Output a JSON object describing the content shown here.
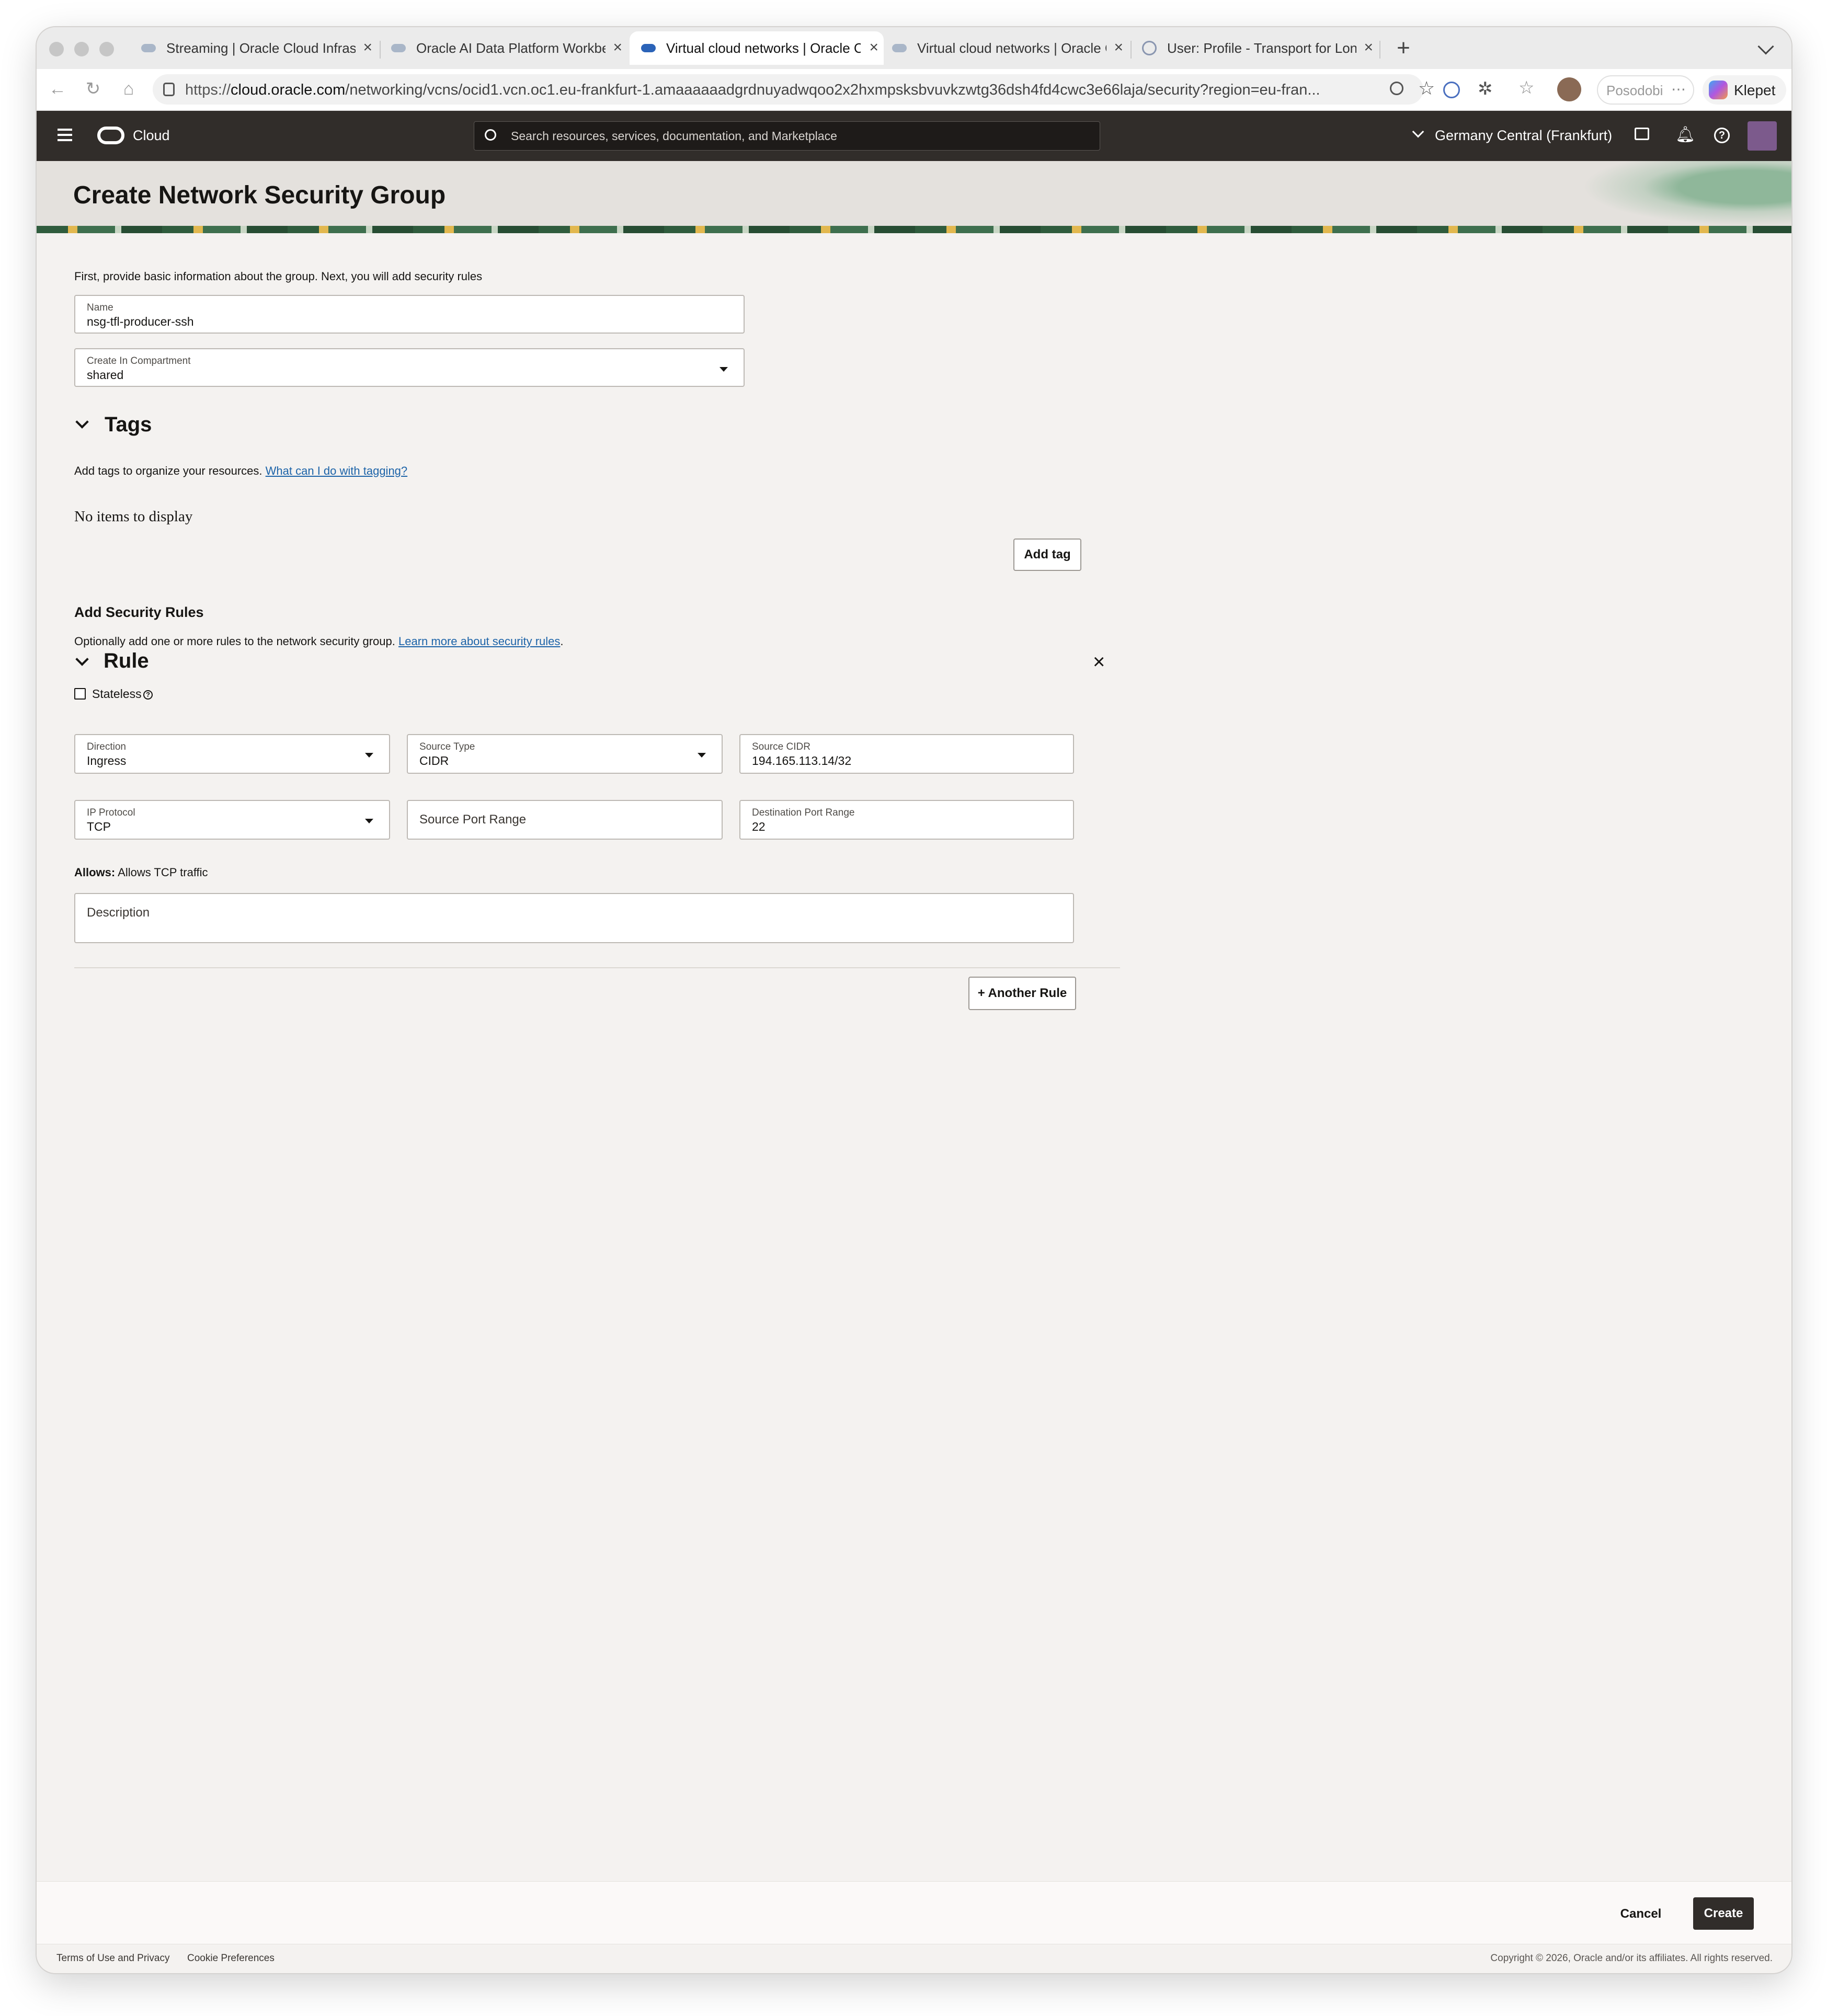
{
  "browser": {
    "tabs": [
      {
        "title": "Streaming | Oracle Cloud Infrast"
      },
      {
        "title": "Oracle AI Data Platform Workbe"
      },
      {
        "title": "Virtual cloud networks | Oracle C"
      },
      {
        "title": "Virtual cloud networks | Oracle C"
      },
      {
        "title": "User: Profile - Transport for Lon"
      }
    ],
    "url_prefix": "https://",
    "url_host": "cloud.oracle.com",
    "url_path": "/networking/vcns/ocid1.vcn.oc1.eu-frankfurt-1.amaaaaaadgrdnuyadwqoo2x2hxmpsksbvuvkzwtg36dsh4fd4cwc3e66laja/security?region=eu-fran...",
    "profile_label": "Posodobi",
    "copilot_label": "Klepet",
    "icons": [
      "back-icon",
      "reload-icon",
      "home-icon",
      "site-info-icon",
      "zoom-icon",
      "bookmark-star-icon",
      "password-icon",
      "extensions-icon",
      "favorites-icon",
      "profile-avatar",
      "more-icon",
      "copilot-icon",
      "new-tab-icon",
      "tab-list-icon"
    ]
  },
  "header": {
    "brand": "Cloud",
    "search_placeholder": "Search resources, services, documentation, and Marketplace",
    "region": "Germany Central (Frankfurt)"
  },
  "page": {
    "title": "Create Network Security Group",
    "intro": "First, provide basic information about the group. Next, you will add security rules",
    "name_field": {
      "label": "Name",
      "value": "nsg-tfl-producer-ssh"
    },
    "compartment_field": {
      "label": "Create In Compartment",
      "value": "shared"
    },
    "tags": {
      "heading": "Tags",
      "description": "Add tags to organize your resources.",
      "link": "What can I do with tagging?",
      "empty": "No items to display",
      "add_button": "Add tag"
    },
    "security": {
      "heading": "Add Security Rules",
      "description": "Optionally add one or more rules to the network security group.",
      "link": "Learn more about security rules",
      "link_suffix": ".",
      "rule": {
        "heading": "Rule",
        "stateless_label": "Stateless",
        "direction": {
          "label": "Direction",
          "value": "Ingress"
        },
        "source_type": {
          "label": "Source Type",
          "value": "CIDR"
        },
        "source_cidr": {
          "label": "Source CIDR",
          "value": "194.165.113.14/32"
        },
        "ip_protocol": {
          "label": "IP Protocol",
          "value": "TCP"
        },
        "source_port_range": {
          "placeholder": "Source Port Range"
        },
        "destination_port_range": {
          "label": "Destination Port Range",
          "value": "22"
        },
        "allows_label": "Allows:",
        "allows_text": "Allows TCP traffic",
        "description_placeholder": "Description"
      },
      "another_rule_button": "+ Another Rule"
    }
  },
  "actions": {
    "cancel": "Cancel",
    "create": "Create"
  },
  "footer": {
    "terms": "Terms of Use and Privacy",
    "cookies": "Cookie Preferences",
    "copyright": "Copyright © 2026, Oracle and/or its affiliates. All rights reserved."
  },
  "colors": {
    "header_bg": "#312d2a",
    "page_bg": "#f4f2f0",
    "primary_button": "#312d2a",
    "link": "#1c63a8"
  }
}
